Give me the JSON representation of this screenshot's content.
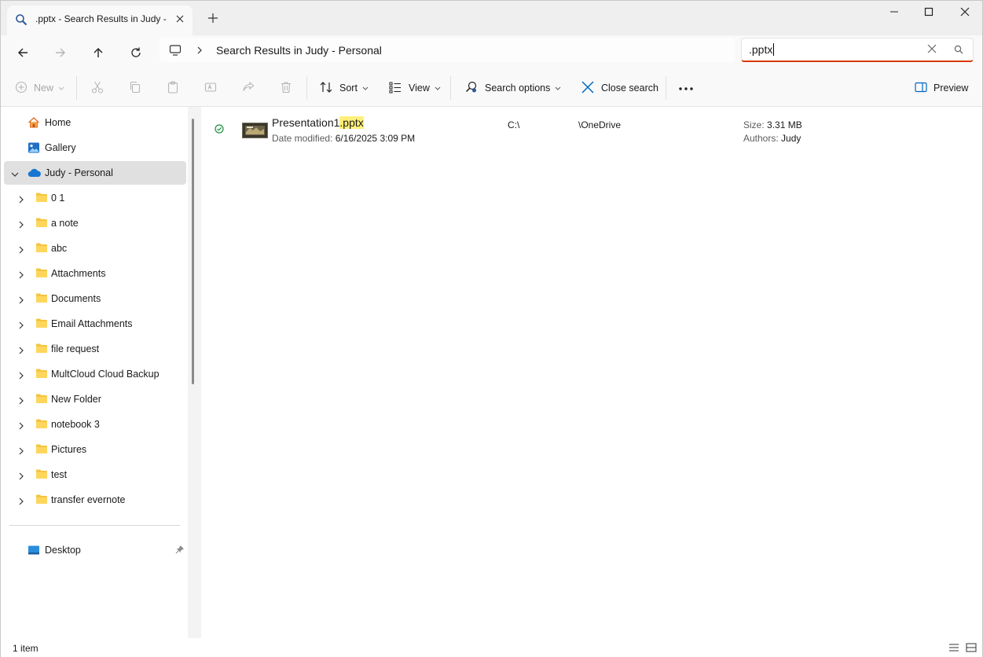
{
  "tab": {
    "title": ".pptx - Search Results in Judy - Personal",
    "icon": "search-icon"
  },
  "window_controls": {
    "minimize": "minimize-icon",
    "maximize": "maximize-icon",
    "close": "close-icon"
  },
  "address": {
    "breadcrumb": "Search Results in Judy - Personal"
  },
  "search": {
    "value": ".pptx"
  },
  "commands": {
    "new": "New",
    "sort": "Sort",
    "view": "View",
    "search_options": "Search options",
    "close_search": "Close search",
    "preview": "Preview"
  },
  "sidebar": {
    "top": [
      {
        "label": "Home",
        "icon": "home-icon"
      },
      {
        "label": "Gallery",
        "icon": "gallery-icon"
      },
      {
        "label": "Judy - Personal",
        "icon": "onedrive-cloud-icon"
      }
    ],
    "folders": [
      {
        "label": "0 1"
      },
      {
        "label": "a note"
      },
      {
        "label": "abc"
      },
      {
        "label": "Attachments"
      },
      {
        "label": "Documents"
      },
      {
        "label": "Email Attachments"
      },
      {
        "label": "file request"
      },
      {
        "label": "MultCloud Cloud Backup"
      },
      {
        "label": "New Folder"
      },
      {
        "label": "notebook 3"
      },
      {
        "label": "Pictures"
      },
      {
        "label": "test"
      },
      {
        "label": "transfer evernote"
      }
    ],
    "pinned": [
      {
        "label": "Desktop",
        "icon": "desktop-icon"
      }
    ]
  },
  "results": [
    {
      "name": "Presentation1",
      "match": ".pptx",
      "date_label": "Date modified:",
      "date": "6/16/2025 3:09 PM",
      "drive": "C:\\",
      "path": "\\OneDrive",
      "size_label": "Size:",
      "size": "3.31 MB",
      "authors_label": "Authors:",
      "authors": "Judy"
    }
  ],
  "status": {
    "count": "1 item"
  },
  "colors": {
    "accent": "#0067c0",
    "search_underline": "#d83b01",
    "highlight": "#ffef7a",
    "folder": "#f4c542"
  }
}
